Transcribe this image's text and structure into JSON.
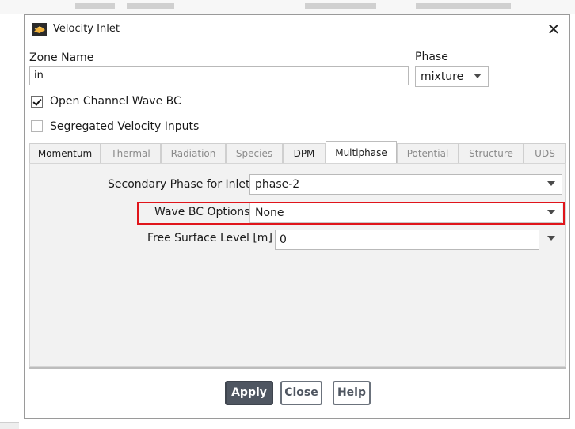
{
  "window": {
    "title": "Velocity Inlet",
    "close_glyph": "✕"
  },
  "zone": {
    "label": "Zone Name",
    "value": "in"
  },
  "phase": {
    "label": "Phase",
    "value": "mixture"
  },
  "checkboxes": [
    {
      "label": "Open Channel Wave BC",
      "checked": true
    },
    {
      "label": "Segregated Velocity Inputs",
      "checked": false
    }
  ],
  "tabs": [
    {
      "label": "Momentum",
      "state": "enabled"
    },
    {
      "label": "Thermal",
      "state": "disabled"
    },
    {
      "label": "Radiation",
      "state": "disabled"
    },
    {
      "label": "Species",
      "state": "disabled"
    },
    {
      "label": "DPM",
      "state": "enabled"
    },
    {
      "label": "Multiphase",
      "state": "active"
    },
    {
      "label": "Potential",
      "state": "disabled"
    },
    {
      "label": "Structure",
      "state": "disabled"
    },
    {
      "label": "UDS",
      "state": "disabled"
    }
  ],
  "multiphase": {
    "secondary_phase": {
      "label": "Secondary Phase for Inlet",
      "value": "phase-2"
    },
    "wave_bc_options": {
      "label": "Wave BC Options",
      "value": "None",
      "highlighted": true
    },
    "free_surface_level": {
      "label": "Free Surface Level [m]",
      "value": "0"
    }
  },
  "buttons": {
    "apply": "Apply",
    "close": "Close",
    "help": "Help"
  },
  "colors": {
    "highlight_border": "#e0151b",
    "primary_button": "#4f5661",
    "panel_bg": "#f2f2f2"
  },
  "icons": {
    "window": "fluent-app-icon",
    "close": "close-icon",
    "dropdown": "chevron-down-icon",
    "check": "checkmark-icon"
  }
}
